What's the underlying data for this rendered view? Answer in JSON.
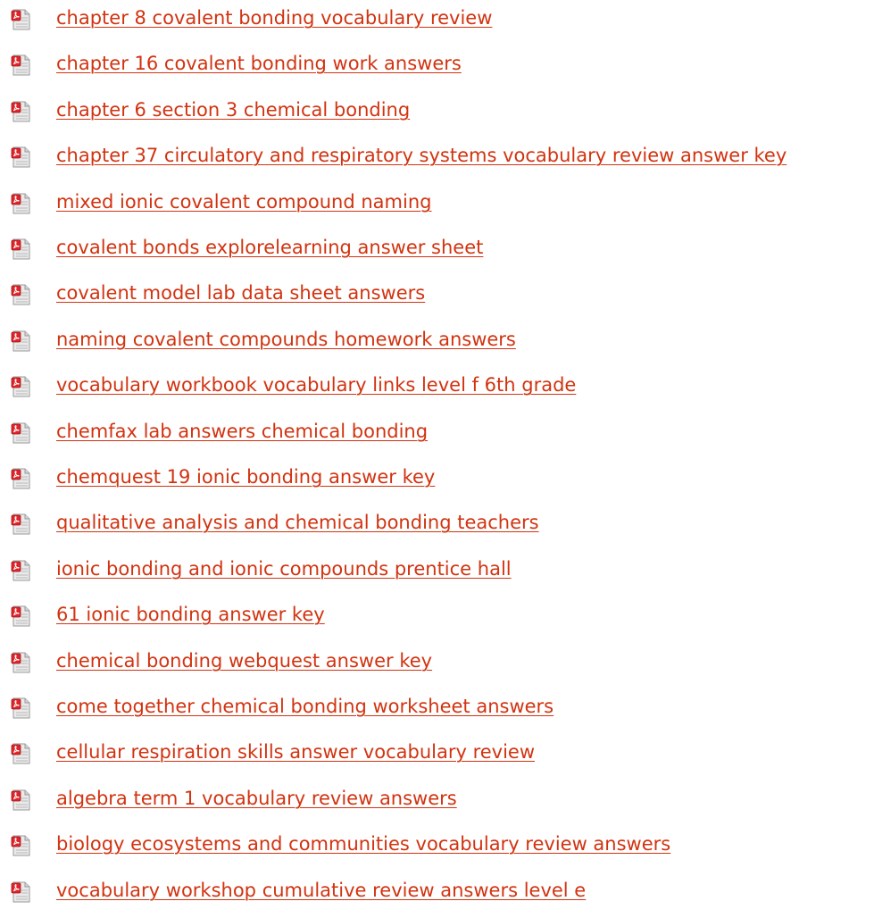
{
  "icon": {
    "name": "pdf-file-icon",
    "paper_color": "#eaeaea",
    "badge_color": "#e0252a"
  },
  "link_color": "#d23310",
  "links": [
    {
      "label": "chapter 8 covalent bonding vocabulary review"
    },
    {
      "label": "chapter 16 covalent bonding work answers"
    },
    {
      "label": "chapter 6 section 3 chemical bonding"
    },
    {
      "label": "chapter 37 circulatory and respiratory systems vocabulary review answer key"
    },
    {
      "label": "mixed ionic covalent compound naming"
    },
    {
      "label": "covalent bonds explorelearning answer sheet"
    },
    {
      "label": "covalent model lab data sheet answers"
    },
    {
      "label": "naming covalent compounds homework answers"
    },
    {
      "label": "vocabulary workbook vocabulary links level f 6th grade"
    },
    {
      "label": "chemfax lab answers chemical bonding"
    },
    {
      "label": "chemquest 19 ionic bonding answer key"
    },
    {
      "label": "qualitative analysis and chemical bonding teachers"
    },
    {
      "label": "ionic bonding and ionic compounds prentice hall"
    },
    {
      "label": "61 ionic bonding answer key"
    },
    {
      "label": "chemical bonding webquest answer key"
    },
    {
      "label": "come together chemical bonding worksheet answers"
    },
    {
      "label": "cellular respiration skills answer vocabulary review"
    },
    {
      "label": "algebra term 1 vocabulary review answers"
    },
    {
      "label": "biology ecosystems and communities vocabulary review answers"
    },
    {
      "label": "vocabulary workshop cumulative review answers level e"
    }
  ]
}
